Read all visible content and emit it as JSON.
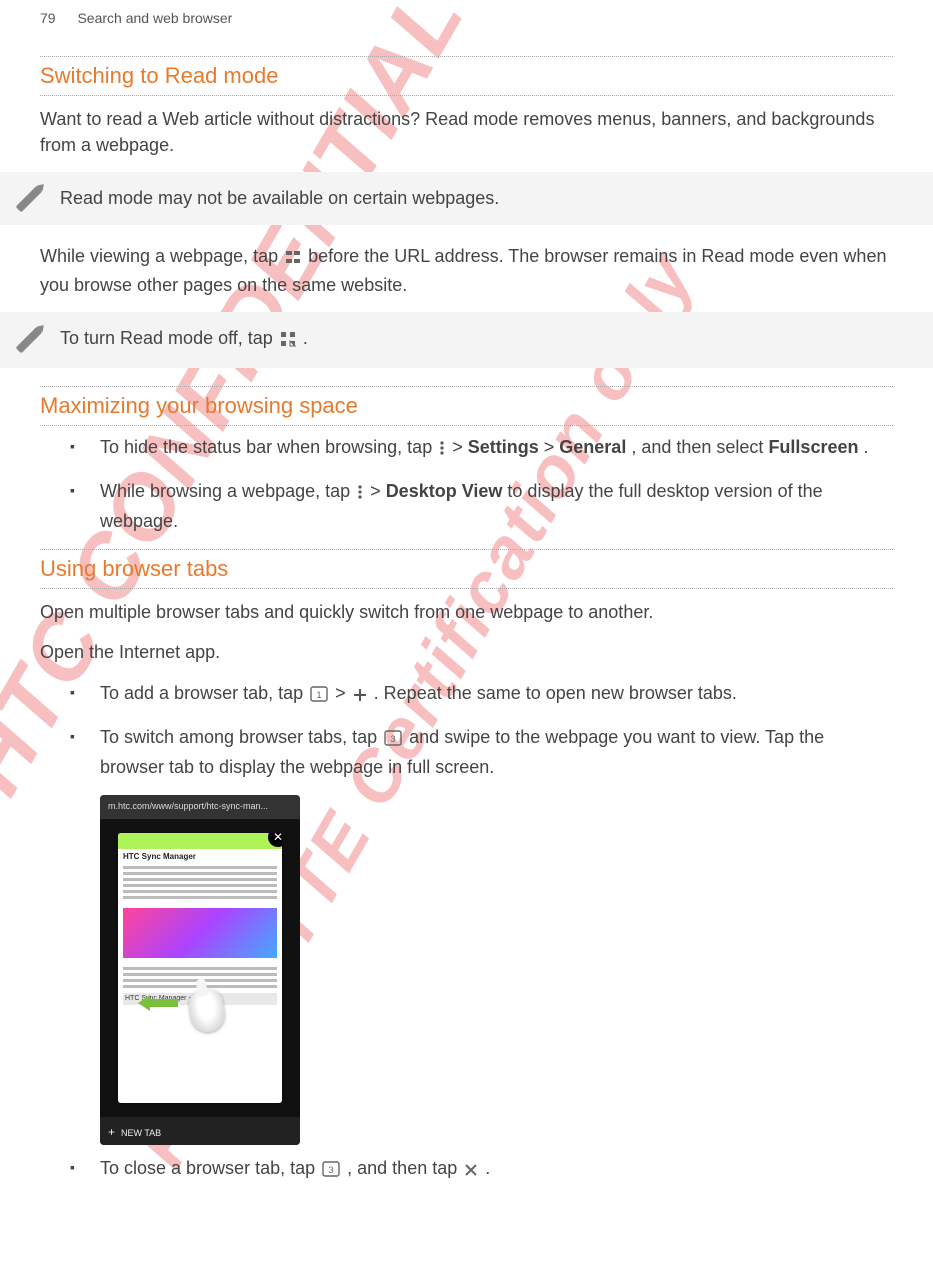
{
  "header": {
    "page_no": "79",
    "section": "Search and web browser"
  },
  "s1": {
    "title": "Switching to Read mode",
    "intro": "Want to read a Web article without distractions? Read mode removes menus, banners, and backgrounds from a webpage.",
    "note1": "Read mode may not be available on certain webpages.",
    "p_before": "While viewing a webpage, tap ",
    "p_after": " before the URL address. The browser remains in Read mode even when you browse other pages on the same website.",
    "note2_before": "To turn Read mode off, tap ",
    "note2_after": "."
  },
  "s2": {
    "title": "Maximizing your browsing space",
    "b1_a": "To hide the status bar when browsing, tap ",
    "b1_b": " > ",
    "b1_settings": "Settings",
    "b1_c": " > ",
    "b1_general": "General",
    "b1_d": ", and then select ",
    "b1_fullscreen": "Fullscreen",
    "b1_e": ".",
    "b2_a": "While browsing a webpage, tap ",
    "b2_b": " > ",
    "b2_desktop": "Desktop View",
    "b2_c": " to display the full desktop version of the webpage."
  },
  "s3": {
    "title": "Using browser tabs",
    "p1": "Open multiple browser tabs and quickly switch from one webpage to another.",
    "p2": "Open the Internet app.",
    "b1_a": "To add a browser tab, tap ",
    "b1_b": " > ",
    "b1_c": ". Repeat the same to open new browser tabs.",
    "b2_a": "To switch among browser tabs, tap ",
    "b2_b": " and swipe to the webpage you want to view. Tap the browser tab to display the webpage in full screen.",
    "screenshot": {
      "url": "m.htc.com/www/support/htc-sync-man...",
      "card_title": "HTC Sync Manager",
      "card_caption": "HTC Sync Manager - H",
      "newtab": "NEW TAB"
    },
    "b3_a": "To close a browser tab, tap ",
    "b3_b": ", and then tap ",
    "b3_c": "."
  },
  "watermarks": {
    "w1": "HTC CONFIDENTIAL",
    "w2": "For R&TTE Certification only"
  },
  "icons": {
    "read_on": "read-mode-on",
    "read_off": "read-mode-off",
    "menu": "menu-dots",
    "tabs1": "tabs-1",
    "plus": "plus",
    "tabs3": "tabs-3",
    "tabs3b": "tabs-3",
    "close_x": "close-x"
  }
}
